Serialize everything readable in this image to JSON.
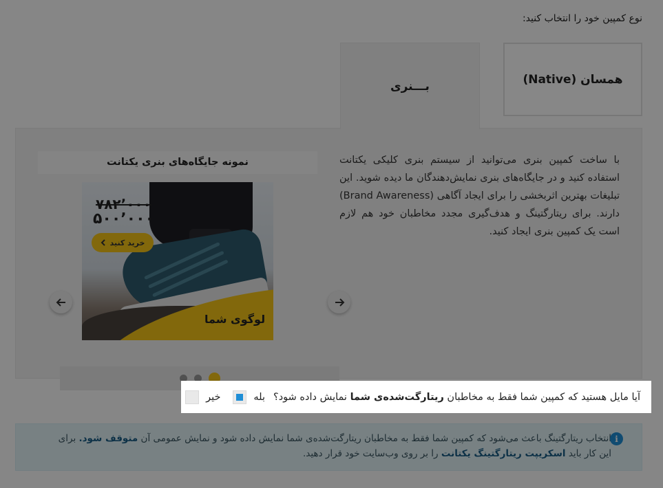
{
  "section_title": "نوع کمپین خود را انتخاب کنید:",
  "campaign_types": {
    "native_label": "همسان (Native)",
    "banner_label": "بـــنری"
  },
  "banner_panel": {
    "description": "با ساخت کمپین بنری می‌توانید از سیستم بنری کلیکی یکتانت استفاده کنید و در جایگاه‌های بنری نمایش‌دهندگان ما دیده شوید. این تبلیغات بهترین اثربخشی را برای ایجاد آگاهی (Brand Awareness) دارند. برای ریتارگتینگ و هدف‌گیری مجدد مخاطبان خود هم لازم است یک کمپین بنری ایجاد کنید.",
    "preview_title": "نمونه جایگاه‌های بنری یکتانت",
    "ad": {
      "old_price": "۷۸۲٬۰۰۰",
      "new_price": "۵۰۰٬۰۰۰",
      "buy_label": "خرید کنید",
      "logo_text": "لوگوی شما"
    },
    "carousel": {
      "dot_count": 3,
      "active_dot": 1
    }
  },
  "retarget_question": {
    "text_before": "آیا مایل هستید که کمپین شما فقط به مخاطبان",
    "text_bold": "ریتارگت‌شده‌ی شما",
    "text_after": "نمایش داده شود؟",
    "yes_label": "بله",
    "no_label": "خیر",
    "selected": "yes"
  },
  "info": {
    "line1_before": "انتخاب ریتارگتینگ باعث می‌شود که کمپین شما فقط به مخاطبان ریتارگت‌شده‌ی شما نمایش داده شود و نمایش عمومی آن",
    "line1_bold": "متوقف شود.",
    "line1_after": "برای",
    "line2_before": "این کار باید",
    "line2_bold": "اسکریپت ریتارگتینگ یکتانت",
    "line2_after": "را بر روی وب‌سایت خود قرار دهید."
  },
  "colors": {
    "accent_yellow": "#f5c518",
    "checkbox_blue": "#1f8ed6",
    "info_bg": "#e3f3f8"
  }
}
